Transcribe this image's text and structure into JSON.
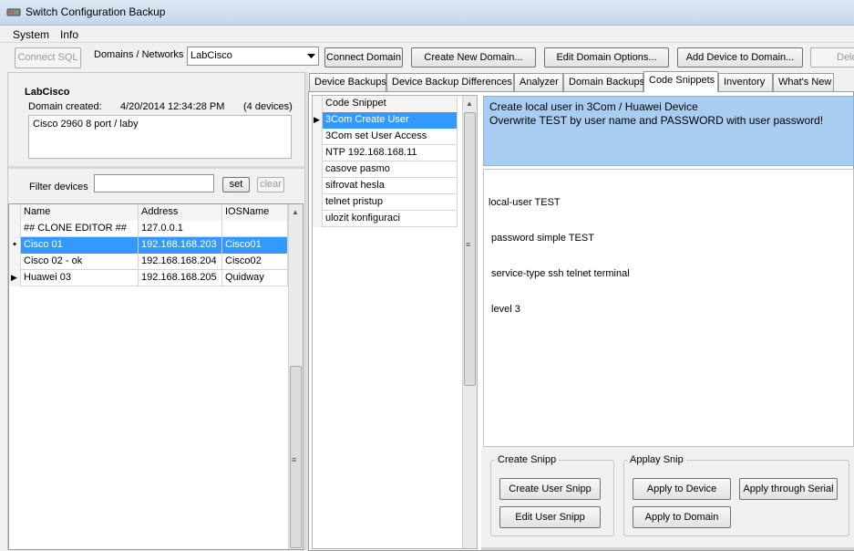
{
  "window": {
    "title": "Switch Configuration Backup"
  },
  "menu": {
    "system": "System",
    "info": "Info"
  },
  "toolbar": {
    "connect_sql": "Connect SQL",
    "domains_label": "Domains / Networks",
    "domain_selected": "LabCisco",
    "connect_domain": "Connect Domain",
    "create_new_domain": "Create New Domain...",
    "edit_domain_options": "Edit Domain Options...",
    "add_device": "Add Device to Domain...",
    "delete": "Dele"
  },
  "domain": {
    "name": "LabCisco",
    "created_label": "Domain created:",
    "created_value": "4/20/2014 12:34:28 PM",
    "device_count": "(4 devices)",
    "notes": "Cisco 2960 8 port / laby"
  },
  "filter": {
    "label": "Filter devices",
    "value": "",
    "set": "set",
    "clear": "clear"
  },
  "devices": {
    "columns": [
      "Name",
      "Address",
      "IOSName"
    ],
    "rows": [
      {
        "marker": "",
        "name": "## CLONE EDITOR ##",
        "address": "127.0.0.1",
        "ios": ""
      },
      {
        "marker": "•",
        "name": "Cisco 01",
        "address": "192.168.168.203",
        "ios": "Cisco01"
      },
      {
        "marker": "",
        "name": "Cisco 02 - ok",
        "address": "192.168.168.204",
        "ios": "Cisco02"
      },
      {
        "marker": "▶",
        "name": "Huawei 03",
        "address": "192.168.168.205",
        "ios": "Quidway"
      }
    ]
  },
  "tabs": [
    "Device Backups",
    "Device Backup Differences",
    "Analyzer",
    "Domain Backups",
    "Code Snippets",
    "Inventory",
    "What's New"
  ],
  "snippets": {
    "header": "Code Snippet",
    "items": [
      "3Com Create User",
      "3Com set User Access",
      "NTP 192.168.168.11",
      "casove pasmo",
      "sifrovat hesla",
      "telnet pristup",
      "ulozit konfiguraci"
    ]
  },
  "snippet_detail": {
    "description_line1": "Create local user in 3Com / Huawei Device",
    "description_line2": "Overwrite TEST by user name and PASSWORD with user password!",
    "code": [
      "local-user TEST",
      " password simple TEST",
      " service-type ssh telnet terminal",
      " level 3"
    ]
  },
  "create_snipp": {
    "label": "Create Snipp",
    "create": "Create User Snipp",
    "edit": "Edit User Snipp"
  },
  "apply_snip": {
    "label": "Applay Snip",
    "device": "Apply to Device",
    "serial": "Apply through Serial",
    "domain": "Apply to Domain"
  },
  "colors": {
    "selection": "#3399ff",
    "description_bg": "#a9cdf0"
  },
  "icons": {
    "app": "app-switch-icon",
    "combo": "chevron-down-icon",
    "row_current": "row-pointer-icon",
    "grip": "splitter-grip-icon"
  }
}
